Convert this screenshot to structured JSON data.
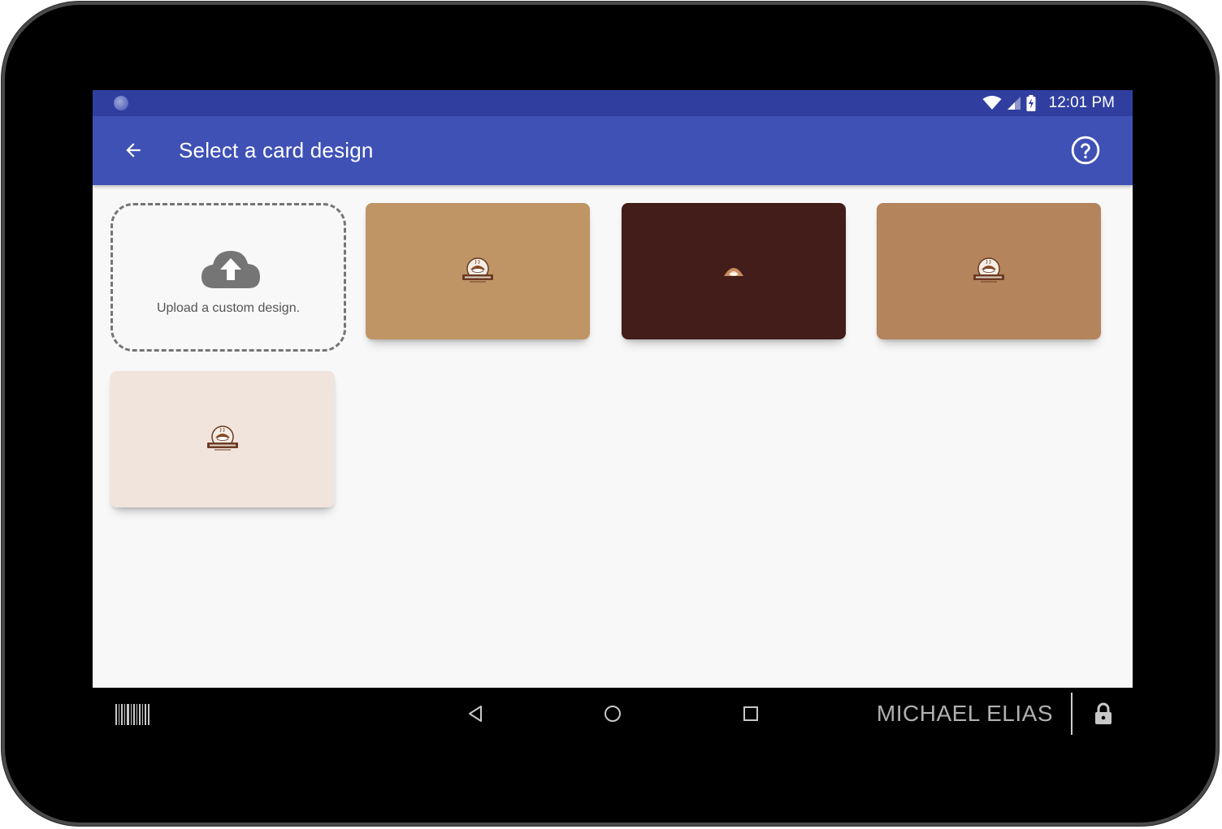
{
  "status_bar": {
    "time": "12:01 PM"
  },
  "app_bar": {
    "title": "Select a card design"
  },
  "upload": {
    "label": "Upload a custom design."
  },
  "designs": [
    {
      "name": "card-design-1",
      "color": "#bf9566",
      "logo_text": "COFFEE HOUSE"
    },
    {
      "name": "card-design-2",
      "color": "#421d1a",
      "logo_text": ""
    },
    {
      "name": "card-design-3",
      "color": "#b4845d",
      "logo_text": "COFFEE HOUSE"
    },
    {
      "name": "card-design-4",
      "color": "#f1e4dc",
      "logo_text": "COFFEE HOUSE"
    }
  ],
  "nav": {
    "user_name": "MICHAEL ELIAS"
  },
  "colors": {
    "primary": "#3f51b5",
    "primary_dark": "#303f9f",
    "background": "#f8f8f8"
  }
}
